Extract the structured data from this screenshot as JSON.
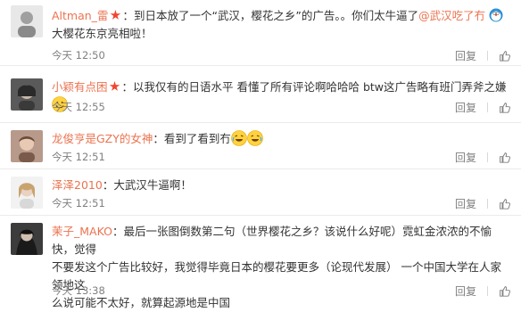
{
  "actions": {
    "reply": "回复",
    "like_icon": "thumbs-up-icon"
  },
  "comments": [
    {
      "user": "Altman_雷",
      "text_before": "：到日本放了一个“武汉，樱花之乡”的广告。。你们太牛逼了",
      "mention": "@武汉吃了冇",
      "text_line2": "大樱花东京亮相啦！",
      "time": "今天 12:50",
      "has_badge": true
    },
    {
      "user": "小颖有点困",
      "text_before": "：以我仅有的日语水平 看懂了所有评论啊哈哈哈  btw这广告略有班门弄斧之嫌",
      "time": "今天 12:55",
      "has_badge": true
    },
    {
      "user": "龙俊亨是GZY的女神",
      "text_before": "：看到了看到冇",
      "time": "今天 12:51",
      "has_badge": false
    },
    {
      "user": "泽泽2010",
      "text_before": "：大武汉牛逼啊！",
      "time": "今天 12:51",
      "has_badge": false
    },
    {
      "user": "茉子_MAKO",
      "text_before": "：最后一张图倒数第二句（世界樱花之乡？该说什么好呢）霓虹金浓浓的不愉快，觉得",
      "text_line2": "不要发这个广告比较好，我觉得毕竟日本的樱花要更多（论现代发展） 一个中国大学在人家领地这",
      "text_line3": "么说可能不太好，就算起源地是中国",
      "time": "今天 13:38",
      "has_badge": false
    }
  ]
}
